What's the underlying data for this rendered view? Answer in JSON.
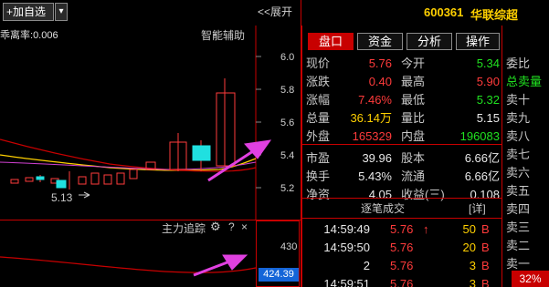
{
  "toolbar": {
    "add_favorite": "+加自选",
    "dropdown_glyph": "▾",
    "expand": "<<展开"
  },
  "stock": {
    "code": "600361",
    "name": "华联综超"
  },
  "kline": {
    "deviation_label": "乖离率:",
    "deviation_value": "0.006",
    "smart_assist": "智能辅助",
    "asterisk": "*",
    "low_marker": "5.13",
    "y_ticks": [
      "6.0",
      "5.8",
      "5.6",
      "5.4",
      "5.2"
    ]
  },
  "sub_indicator": {
    "title": "主力追踪",
    "help": "?",
    "close": "×",
    "tick": "430",
    "current": "424.39"
  },
  "tabs": [
    "盘口",
    "资金",
    "分析",
    "操作"
  ],
  "quote": {
    "rows": [
      {
        "l1": "现价",
        "v1": "5.76",
        "c1": "red",
        "l2": "今开",
        "v2": "5.34",
        "c2": "green"
      },
      {
        "l1": "涨跌",
        "v1": "0.40",
        "c1": "red",
        "l2": "最高",
        "v2": "5.90",
        "c2": "red"
      },
      {
        "l1": "涨幅",
        "v1": "7.46%",
        "c1": "red",
        "l2": "最低",
        "v2": "5.32",
        "c2": "green"
      },
      {
        "l1": "总量",
        "v1": "36.14万",
        "c1": "yel",
        "l2": "量比",
        "v2": "5.15",
        "c2": "white"
      },
      {
        "l1": "外盘",
        "v1": "165329",
        "c1": "red",
        "l2": "内盘",
        "v2": "196083",
        "c2": "green"
      },
      {
        "l1": "市盈",
        "v1": "39.96",
        "c1": "white",
        "l2": "股本",
        "v2": "6.66亿",
        "c2": "white"
      },
      {
        "l1": "换手",
        "v1": "5.43%",
        "c1": "white",
        "l2": "流通",
        "v2": "6.66亿",
        "c2": "white"
      },
      {
        "l1": "净资",
        "v1": "4.05",
        "c1": "white",
        "l2": "收益(三)",
        "v2": "0.108",
        "c2": "white"
      }
    ]
  },
  "ticks": {
    "title": "逐笔成交",
    "more": "[详]",
    "rows": [
      {
        "time": "14:59:49",
        "price": "5.76",
        "arrow": "↑",
        "vol": "50",
        "side": "B"
      },
      {
        "time": "14:59:50",
        "price": "5.76",
        "arrow": "",
        "vol": "20",
        "side": "B"
      },
      {
        "time": "2",
        "price": "5.76",
        "arrow": "",
        "vol": "3",
        "side": "B"
      },
      {
        "time": "14:59:51",
        "price": "5.76",
        "arrow": "",
        "vol": "3",
        "side": "B"
      }
    ]
  },
  "order_column": {
    "items": [
      "委比",
      "总卖量",
      "卖十",
      "卖九",
      "卖八",
      "卖七",
      "卖六",
      "卖五",
      "卖四",
      "卖三",
      "卖二",
      "卖一"
    ],
    "percent": "32%"
  },
  "colors": {
    "up": "#ff3b3b",
    "down": "#20e020",
    "accent_red": "#c80000",
    "highlight_yellow": "#ffd000",
    "magenta_arrow": "#e040e0"
  }
}
